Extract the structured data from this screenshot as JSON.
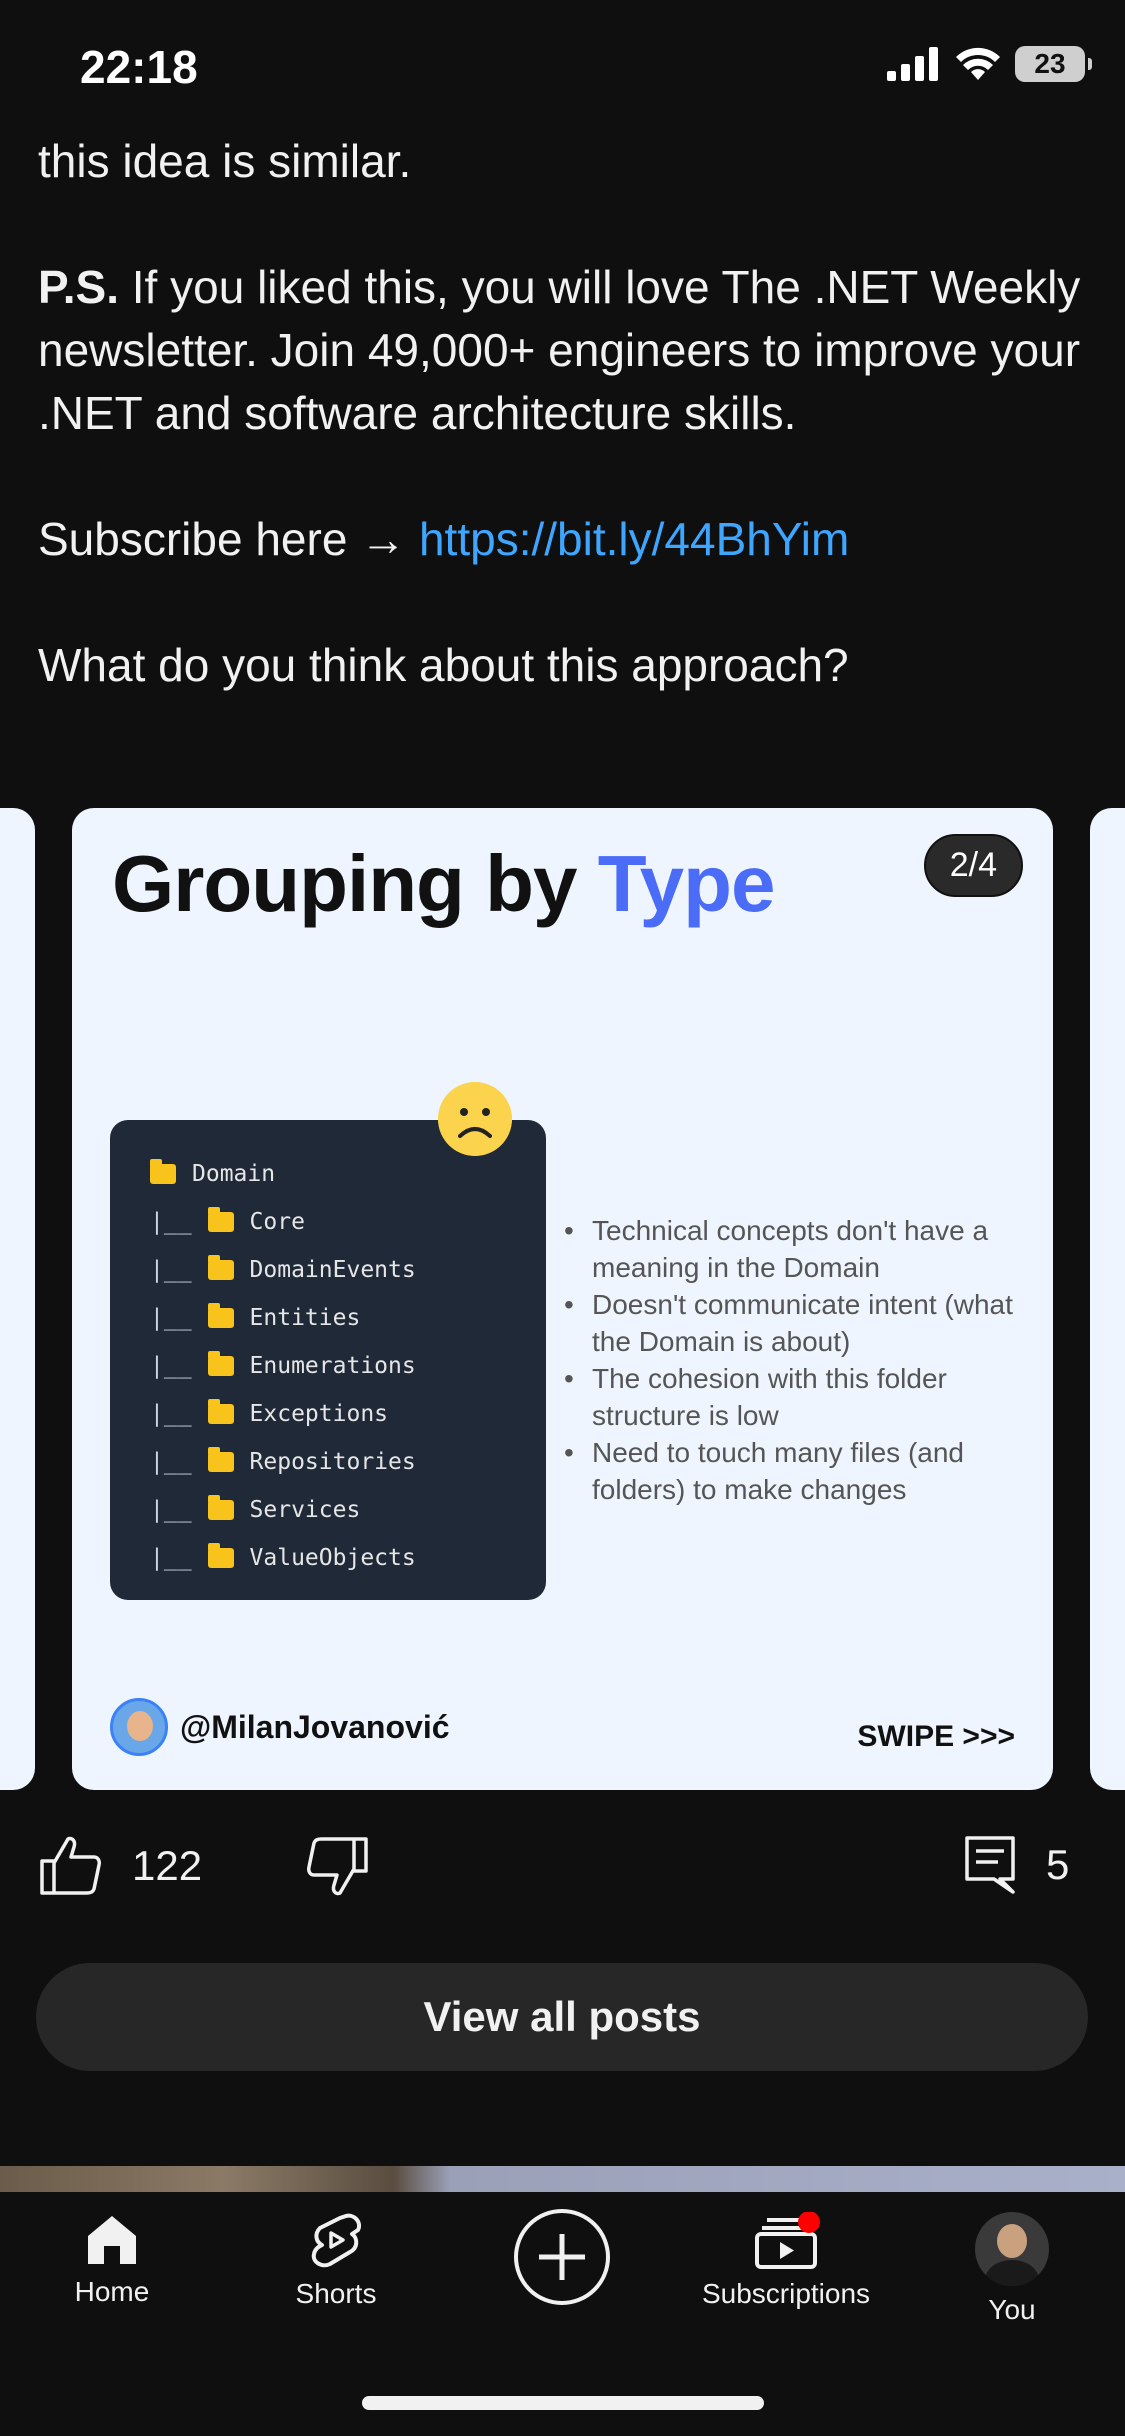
{
  "status_bar": {
    "time": "22:18",
    "battery": "23"
  },
  "post": {
    "line1": "this idea is similar.",
    "ps_label": "P.S.",
    "ps_text": " If you liked this, you will love The .NET Weekly newsletter. Join 49,000+ engineers to improve your .NET and software architecture skills.",
    "subscribe_prefix": "Subscribe here → ",
    "subscribe_link": "https://bit.ly/44BhYim",
    "question": "What do you think about this approach?"
  },
  "slide": {
    "title_main": "Grouping by ",
    "title_accent": "Type",
    "page": "2/4",
    "folders": [
      {
        "branch": "",
        "name": "Domain"
      },
      {
        "branch": "|__",
        "name": "Core"
      },
      {
        "branch": "|__",
        "name": "DomainEvents"
      },
      {
        "branch": "|__",
        "name": "Entities"
      },
      {
        "branch": "|__",
        "name": "Enumerations"
      },
      {
        "branch": "|__",
        "name": "Exceptions"
      },
      {
        "branch": "|__",
        "name": "Repositories"
      },
      {
        "branch": "|__",
        "name": "Services"
      },
      {
        "branch": "|__",
        "name": "ValueObjects"
      }
    ],
    "bullets": [
      "Technical concepts don't have a meaning in the Domain",
      "Doesn't communicate intent (what the Domain is about)",
      "The cohesion with this folder structure is low",
      "Need to touch many files (and folders) to make changes"
    ],
    "author": "@MilanJovanović",
    "swipe": "SWIPE >>>"
  },
  "actions": {
    "likes": "122",
    "comments": "5"
  },
  "view_all_label": "View all posts",
  "nav": {
    "home": "Home",
    "shorts": "Shorts",
    "subscriptions": "Subscriptions",
    "you": "You"
  },
  "colors": {
    "accent": "#4a6cf7",
    "link": "#3ea6ff",
    "notification": "#ff0000"
  }
}
